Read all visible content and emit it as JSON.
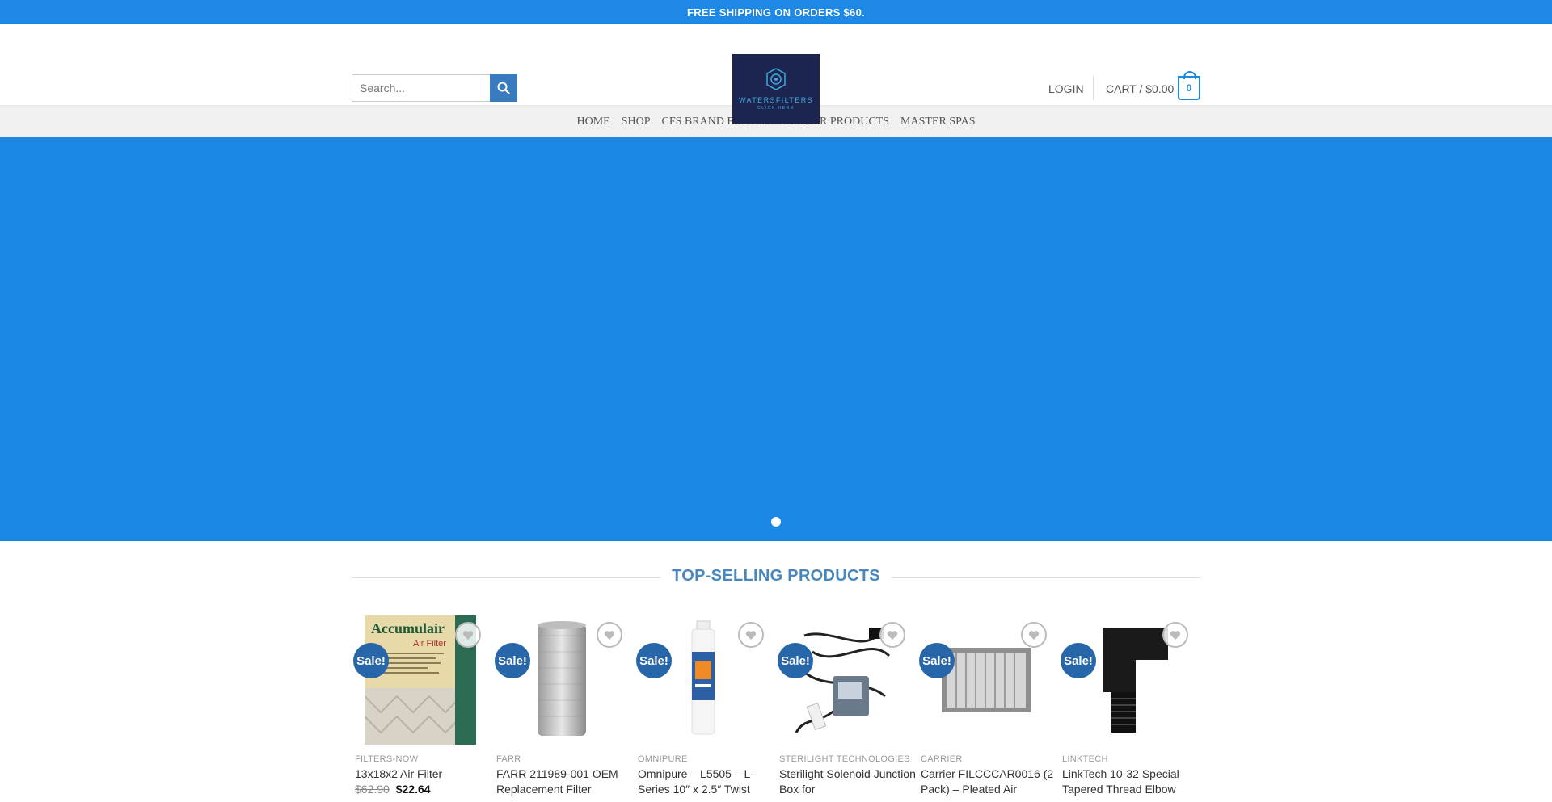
{
  "topbar": {
    "text": "FREE SHIPPING ON ORDERS $60."
  },
  "header": {
    "search_placeholder": "Search...",
    "logo_text": "WATERSFILTERS",
    "logo_sub": "CLICK HERE",
    "login_label": "LOGIN",
    "cart_label": "CART / $0.00",
    "cart_count": "0"
  },
  "nav": {
    "items": [
      "HOME",
      "SHOP",
      "CFS BRAND FILTERS",
      "COLDER PRODUCTS",
      "MASTER SPAS"
    ]
  },
  "section": {
    "title": "TOP-SELLING PRODUCTS"
  },
  "products": [
    {
      "category": "FILTERS-NOW",
      "title": "13x18x2 Air Filter",
      "old_price": "$62.90",
      "price": "$22.64",
      "sale": "Sale!"
    },
    {
      "category": "FARR",
      "title": "FARR 211989-001 OEM Replacement Filter",
      "old_price": "",
      "price": "",
      "sale": "Sale!"
    },
    {
      "category": "OMNIPURE",
      "title": "Omnipure – L5505 – L-Series 10″ x 2.5″ Twist",
      "old_price": "",
      "price": "",
      "sale": "Sale!"
    },
    {
      "category": "STERILIGHT TECHNOLOGIES",
      "title": "Sterilight Solenoid Junction Box for",
      "old_price": "",
      "price": "",
      "sale": "Sale!"
    },
    {
      "category": "CARRIER",
      "title": "Carrier FILCCCAR0016 (2 Pack) – Pleated Air",
      "old_price": "",
      "price": "",
      "sale": "Sale!"
    },
    {
      "category": "LINKTECH",
      "title": "LinkTech 10-32 Special Tapered Thread Elbow",
      "old_price": "",
      "price": "",
      "sale": "Sale!"
    }
  ],
  "colors": {
    "primary": "#1e88e5",
    "hero": "#1a88e4",
    "sale_badge": "#2766a8",
    "title_blue": "#4a87bd"
  }
}
